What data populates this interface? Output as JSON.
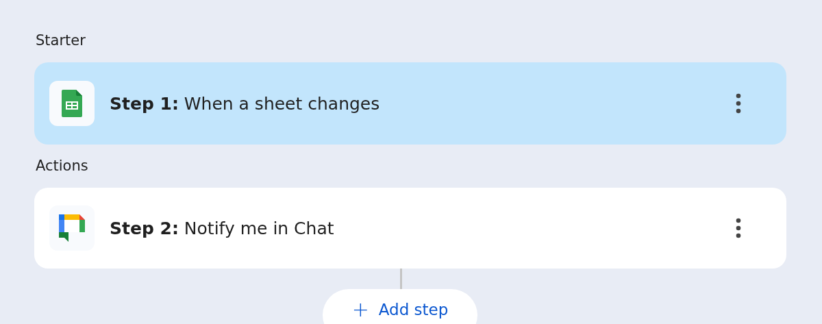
{
  "sections": [
    {
      "label": "Starter",
      "steps": [
        {
          "kind": "sheets",
          "text": "**Step 1:** When a sheet changes",
          "selected": true
        }
      ]
    },
    {
      "label": "Actions",
      "steps": [
        {
          "kind": "chat",
          "text": "**Step 2:** Notify me in Chat",
          "selected": false
        }
      ]
    }
  ],
  "add_button": {
    "icon": "+",
    "label": "Add step"
  }
}
